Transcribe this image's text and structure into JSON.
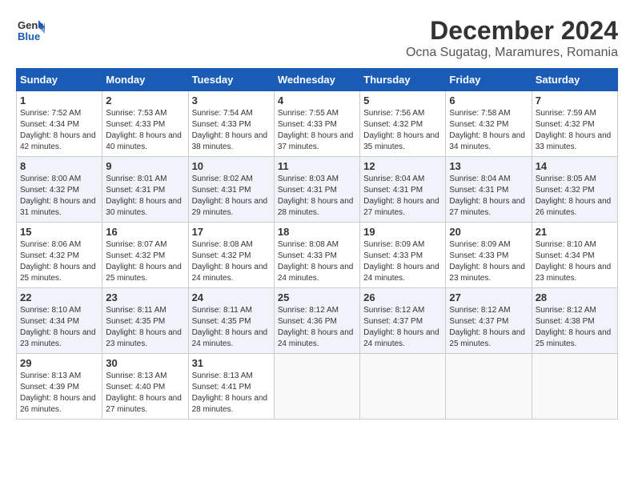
{
  "header": {
    "logo_line1": "General",
    "logo_line2": "Blue",
    "title": "December 2024",
    "subtitle": "Ocna Sugatag, Maramures, Romania"
  },
  "weekdays": [
    "Sunday",
    "Monday",
    "Tuesday",
    "Wednesday",
    "Thursday",
    "Friday",
    "Saturday"
  ],
  "weeks": [
    [
      {
        "day": "1",
        "sunrise": "7:52 AM",
        "sunset": "4:34 PM",
        "daylight": "8 hours and 42 minutes."
      },
      {
        "day": "2",
        "sunrise": "7:53 AM",
        "sunset": "4:33 PM",
        "daylight": "8 hours and 40 minutes."
      },
      {
        "day": "3",
        "sunrise": "7:54 AM",
        "sunset": "4:33 PM",
        "daylight": "8 hours and 38 minutes."
      },
      {
        "day": "4",
        "sunrise": "7:55 AM",
        "sunset": "4:33 PM",
        "daylight": "8 hours and 37 minutes."
      },
      {
        "day": "5",
        "sunrise": "7:56 AM",
        "sunset": "4:32 PM",
        "daylight": "8 hours and 35 minutes."
      },
      {
        "day": "6",
        "sunrise": "7:58 AM",
        "sunset": "4:32 PM",
        "daylight": "8 hours and 34 minutes."
      },
      {
        "day": "7",
        "sunrise": "7:59 AM",
        "sunset": "4:32 PM",
        "daylight": "8 hours and 33 minutes."
      }
    ],
    [
      {
        "day": "8",
        "sunrise": "8:00 AM",
        "sunset": "4:32 PM",
        "daylight": "8 hours and 31 minutes."
      },
      {
        "day": "9",
        "sunrise": "8:01 AM",
        "sunset": "4:31 PM",
        "daylight": "8 hours and 30 minutes."
      },
      {
        "day": "10",
        "sunrise": "8:02 AM",
        "sunset": "4:31 PM",
        "daylight": "8 hours and 29 minutes."
      },
      {
        "day": "11",
        "sunrise": "8:03 AM",
        "sunset": "4:31 PM",
        "daylight": "8 hours and 28 minutes."
      },
      {
        "day": "12",
        "sunrise": "8:04 AM",
        "sunset": "4:31 PM",
        "daylight": "8 hours and 27 minutes."
      },
      {
        "day": "13",
        "sunrise": "8:04 AM",
        "sunset": "4:31 PM",
        "daylight": "8 hours and 27 minutes."
      },
      {
        "day": "14",
        "sunrise": "8:05 AM",
        "sunset": "4:32 PM",
        "daylight": "8 hours and 26 minutes."
      }
    ],
    [
      {
        "day": "15",
        "sunrise": "8:06 AM",
        "sunset": "4:32 PM",
        "daylight": "8 hours and 25 minutes."
      },
      {
        "day": "16",
        "sunrise": "8:07 AM",
        "sunset": "4:32 PM",
        "daylight": "8 hours and 25 minutes."
      },
      {
        "day": "17",
        "sunrise": "8:08 AM",
        "sunset": "4:32 PM",
        "daylight": "8 hours and 24 minutes."
      },
      {
        "day": "18",
        "sunrise": "8:08 AM",
        "sunset": "4:33 PM",
        "daylight": "8 hours and 24 minutes."
      },
      {
        "day": "19",
        "sunrise": "8:09 AM",
        "sunset": "4:33 PM",
        "daylight": "8 hours and 24 minutes."
      },
      {
        "day": "20",
        "sunrise": "8:09 AM",
        "sunset": "4:33 PM",
        "daylight": "8 hours and 23 minutes."
      },
      {
        "day": "21",
        "sunrise": "8:10 AM",
        "sunset": "4:34 PM",
        "daylight": "8 hours and 23 minutes."
      }
    ],
    [
      {
        "day": "22",
        "sunrise": "8:10 AM",
        "sunset": "4:34 PM",
        "daylight": "8 hours and 23 minutes."
      },
      {
        "day": "23",
        "sunrise": "8:11 AM",
        "sunset": "4:35 PM",
        "daylight": "8 hours and 23 minutes."
      },
      {
        "day": "24",
        "sunrise": "8:11 AM",
        "sunset": "4:35 PM",
        "daylight": "8 hours and 24 minutes."
      },
      {
        "day": "25",
        "sunrise": "8:12 AM",
        "sunset": "4:36 PM",
        "daylight": "8 hours and 24 minutes."
      },
      {
        "day": "26",
        "sunrise": "8:12 AM",
        "sunset": "4:37 PM",
        "daylight": "8 hours and 24 minutes."
      },
      {
        "day": "27",
        "sunrise": "8:12 AM",
        "sunset": "4:37 PM",
        "daylight": "8 hours and 25 minutes."
      },
      {
        "day": "28",
        "sunrise": "8:12 AM",
        "sunset": "4:38 PM",
        "daylight": "8 hours and 25 minutes."
      }
    ],
    [
      {
        "day": "29",
        "sunrise": "8:13 AM",
        "sunset": "4:39 PM",
        "daylight": "8 hours and 26 minutes."
      },
      {
        "day": "30",
        "sunrise": "8:13 AM",
        "sunset": "4:40 PM",
        "daylight": "8 hours and 27 minutes."
      },
      {
        "day": "31",
        "sunrise": "8:13 AM",
        "sunset": "4:41 PM",
        "daylight": "8 hours and 28 minutes."
      },
      null,
      null,
      null,
      null
    ]
  ]
}
